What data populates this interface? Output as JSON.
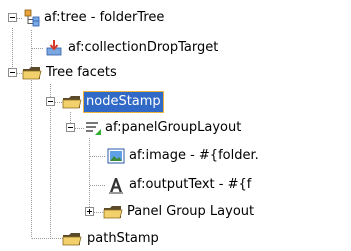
{
  "tree": {
    "nodes": [
      {
        "label": "af:tree - folderTree",
        "icon": "tree-component-icon"
      },
      {
        "label": "af:collectionDropTarget",
        "icon": "drop-target-icon"
      },
      {
        "label": "Tree facets",
        "icon": "folder-icon"
      },
      {
        "label": "nodeStamp",
        "icon": "folder-icon",
        "selected": true
      },
      {
        "label": "af:panelGroupLayout",
        "icon": "panel-group-layout-icon"
      },
      {
        "label": "af:image - #{folder.",
        "icon": "image-icon"
      },
      {
        "label": "af:outputText - #{f",
        "icon": "output-text-icon"
      },
      {
        "label": "Panel Group Layout",
        "icon": "folder-icon"
      },
      {
        "label": "pathStamp",
        "icon": "folder-icon"
      }
    ]
  },
  "colors": {
    "selection": "#3169c6",
    "selection_border": "#e8a830",
    "folder": "#f2d06b",
    "guide": "#9a9a9a"
  }
}
